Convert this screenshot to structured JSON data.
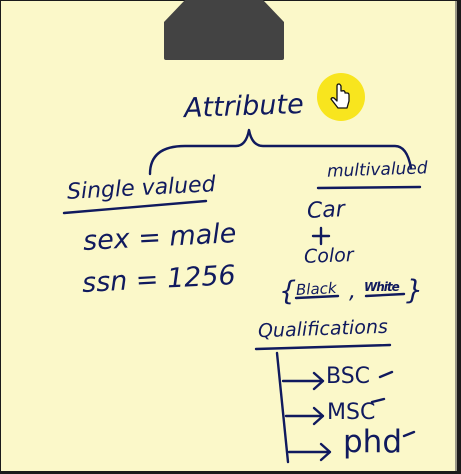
{
  "diagram": {
    "root": "Attribute",
    "left_branch": {
      "label": "Single valued",
      "examples": [
        "sex = male",
        "ssn = 1256"
      ]
    },
    "right_branch": {
      "label": "multivalued",
      "entity": "Car",
      "attribute": "Color",
      "values_open": "{",
      "values": [
        "Black",
        "White"
      ],
      "values_close": "}",
      "values_separator": ",",
      "qualifications": {
        "label": "Qualifications",
        "items": [
          "BSC",
          "MSC",
          "phd"
        ]
      }
    }
  },
  "colors": {
    "paper": "#fbf8c9",
    "ink": "#101a5e",
    "clip": "#434343",
    "highlight": "#f7e200"
  },
  "icons": [
    "binder-clip-icon",
    "hand-pointer-icon"
  ]
}
